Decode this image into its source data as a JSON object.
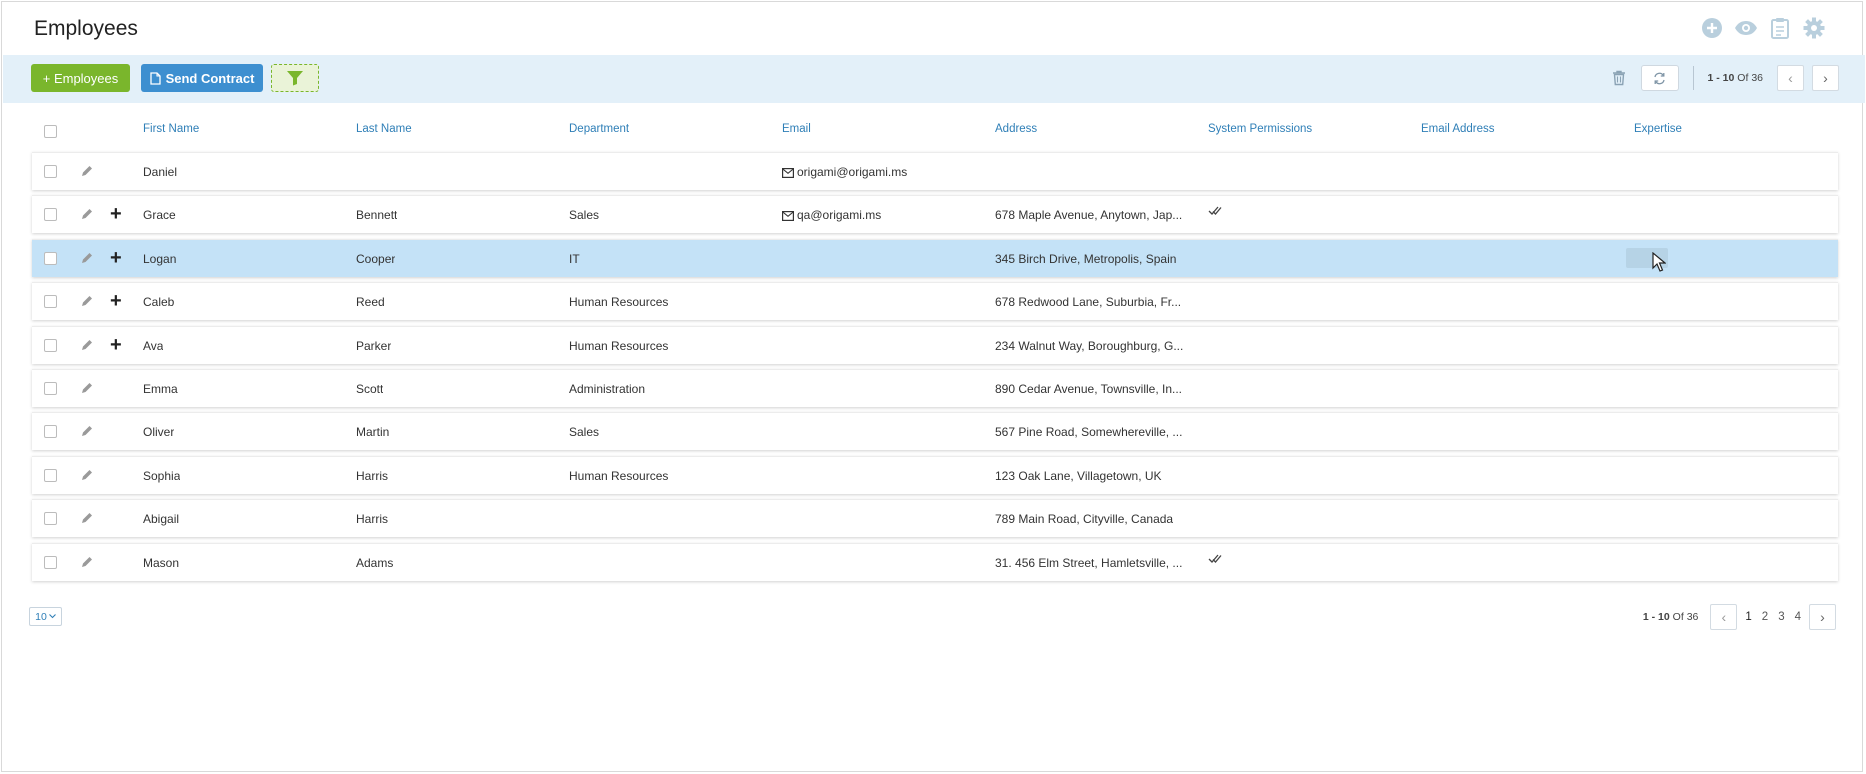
{
  "header": {
    "title": "Employees",
    "icons": [
      "add-circle-icon",
      "eye-icon",
      "clipboard-icon",
      "gear-icon"
    ]
  },
  "toolbar": {
    "add_label": "+ Employees",
    "send_label": "Send Contract",
    "pager": {
      "range": "1 - 10",
      "of_label": "Of",
      "total": "36"
    }
  },
  "table": {
    "columns": [
      "First Name",
      "Last Name",
      "Department",
      "Email",
      "Address",
      "System Permissions",
      "Email Address",
      "Expertise"
    ],
    "rows": [
      {
        "first": "Daniel",
        "last": "",
        "department": "",
        "email": "origami@origami.ms",
        "address": "",
        "permission": false,
        "expandable": false,
        "selected": false
      },
      {
        "first": "Grace",
        "last": "Bennett",
        "department": "Sales",
        "email": "qa@origami.ms",
        "address": "678 Maple Avenue, Anytown, Jap...",
        "permission": true,
        "expandable": true,
        "selected": false
      },
      {
        "first": "Logan",
        "last": "Cooper",
        "department": "IT",
        "email": "",
        "address": "345 Birch Drive, Metropolis, Spain",
        "permission": false,
        "expandable": true,
        "selected": true
      },
      {
        "first": "Caleb",
        "last": "Reed",
        "department": "Human Resources",
        "email": "",
        "address": "678 Redwood Lane, Suburbia, Fr...",
        "permission": false,
        "expandable": true,
        "selected": false
      },
      {
        "first": "Ava",
        "last": "Parker",
        "department": "Human Resources",
        "email": "",
        "address": "234 Walnut Way, Boroughburg, G...",
        "permission": false,
        "expandable": true,
        "selected": false
      },
      {
        "first": "Emma",
        "last": "Scott",
        "department": "Administration",
        "email": "",
        "address": "890 Cedar Avenue, Townsville, In...",
        "permission": false,
        "expandable": false,
        "selected": false
      },
      {
        "first": "Oliver",
        "last": "Martin",
        "department": "Sales",
        "email": "",
        "address": "567 Pine Road, Somewhereville, ...",
        "permission": false,
        "expandable": false,
        "selected": false
      },
      {
        "first": "Sophia",
        "last": "Harris",
        "department": "Human Resources",
        "email": "",
        "address": "123 Oak Lane, Villagetown, UK",
        "permission": false,
        "expandable": false,
        "selected": false
      },
      {
        "first": "Abigail",
        "last": "Harris",
        "department": "",
        "email": "",
        "address": "789 Main Road, Cityville, Canada",
        "permission": false,
        "expandable": false,
        "selected": false
      },
      {
        "first": "Mason",
        "last": "Adams",
        "department": "",
        "email": "",
        "address": "31. 456 Elm Street, Hamletsville, ...",
        "permission": true,
        "expandable": false,
        "selected": false
      }
    ]
  },
  "footer": {
    "page_size": "10",
    "range": "1 - 10",
    "of_label": "Of",
    "total": "36",
    "pages": [
      "1",
      "2",
      "3",
      "4"
    ],
    "current_page": "1"
  },
  "colors": {
    "accent_blue": "#2f7fb7",
    "add_green": "#7ab62c",
    "send_blue": "#3d8fd0",
    "toolbar_bg": "#e3f0f9",
    "selected_row": "#c4e2f7"
  }
}
